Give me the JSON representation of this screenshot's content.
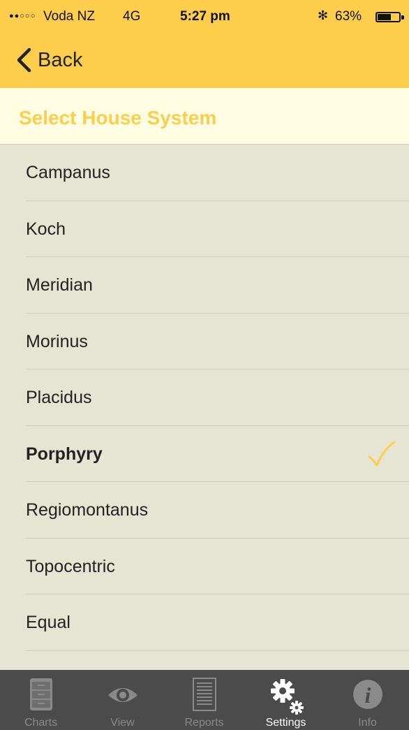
{
  "status_bar": {
    "signal": "●●○○○",
    "carrier": "Voda NZ",
    "network": "4G",
    "time": "5:27 pm",
    "bluetooth_icon": "bluetooth-icon",
    "battery_percent": "63%",
    "battery_level": 0.63
  },
  "nav": {
    "back_label": "Back",
    "back_icon": "chevron-left-icon"
  },
  "section": {
    "title": "Select House System"
  },
  "house_systems": [
    {
      "label": "Campanus",
      "selected": false
    },
    {
      "label": "Koch",
      "selected": false
    },
    {
      "label": "Meridian",
      "selected": false
    },
    {
      "label": "Morinus",
      "selected": false
    },
    {
      "label": "Placidus",
      "selected": false
    },
    {
      "label": "Porphyry",
      "selected": true
    },
    {
      "label": "Regiomontanus",
      "selected": false
    },
    {
      "label": "Topocentric",
      "selected": false
    },
    {
      "label": "Equal",
      "selected": false
    }
  ],
  "tabs": [
    {
      "label": "Charts",
      "icon": "file-cabinet-icon",
      "active": false
    },
    {
      "label": "View",
      "icon": "eye-icon",
      "active": false
    },
    {
      "label": "Reports",
      "icon": "document-icon",
      "active": false
    },
    {
      "label": "Settings",
      "icon": "gears-icon",
      "active": true
    },
    {
      "label": "Info",
      "icon": "info-icon",
      "active": false
    }
  ],
  "colors": {
    "accent": "#fdcd4c",
    "list_background": "#e6e4d3",
    "section_background": "#fffde2",
    "tabbar_background": "#4b4b4b",
    "checkmark": "#fdcd4c"
  }
}
